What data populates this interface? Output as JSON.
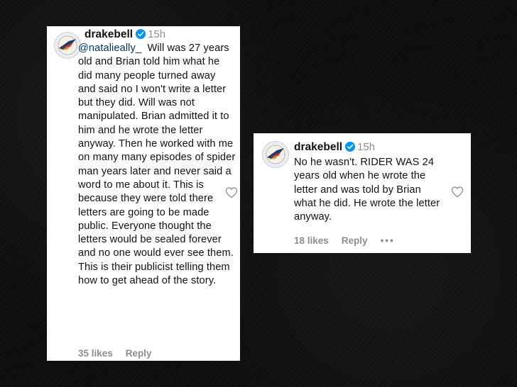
{
  "comments": [
    {
      "username": "drakebell",
      "time": "15h",
      "mention": "@natalieally_",
      "text": "Will was 27 years old and Brian told him what he did many people turned away and said no I won't write a letter but they did. Will was not manipulated. Brian admitted it to him and he wrote the letter anyway. Then he worked with me on many many episodes of spider man years later and never said a word to me about it. This is because they were told there letters are going to be made public. Everyone thought the letters would be sealed forever and no one would ever see them. This is their publicist telling them how to get ahead of the story.",
      "likes": "35 likes",
      "reply": "Reply"
    },
    {
      "username": "drakebell",
      "time": "15h",
      "text": "No he wasn't. RIDER WAS 24 years old when he wrote the letter and was told by Brian what he did. He wrote the letter anyway.",
      "likes": "18 likes",
      "reply": "Reply",
      "more": "•••"
    }
  ],
  "icons": {
    "verified": "verified-badge-icon",
    "like": "heart-icon",
    "more": "more-options-icon"
  },
  "colors": {
    "verified": "#0095f6",
    "mention": "#00376b",
    "muted": "#8e8e8e"
  }
}
